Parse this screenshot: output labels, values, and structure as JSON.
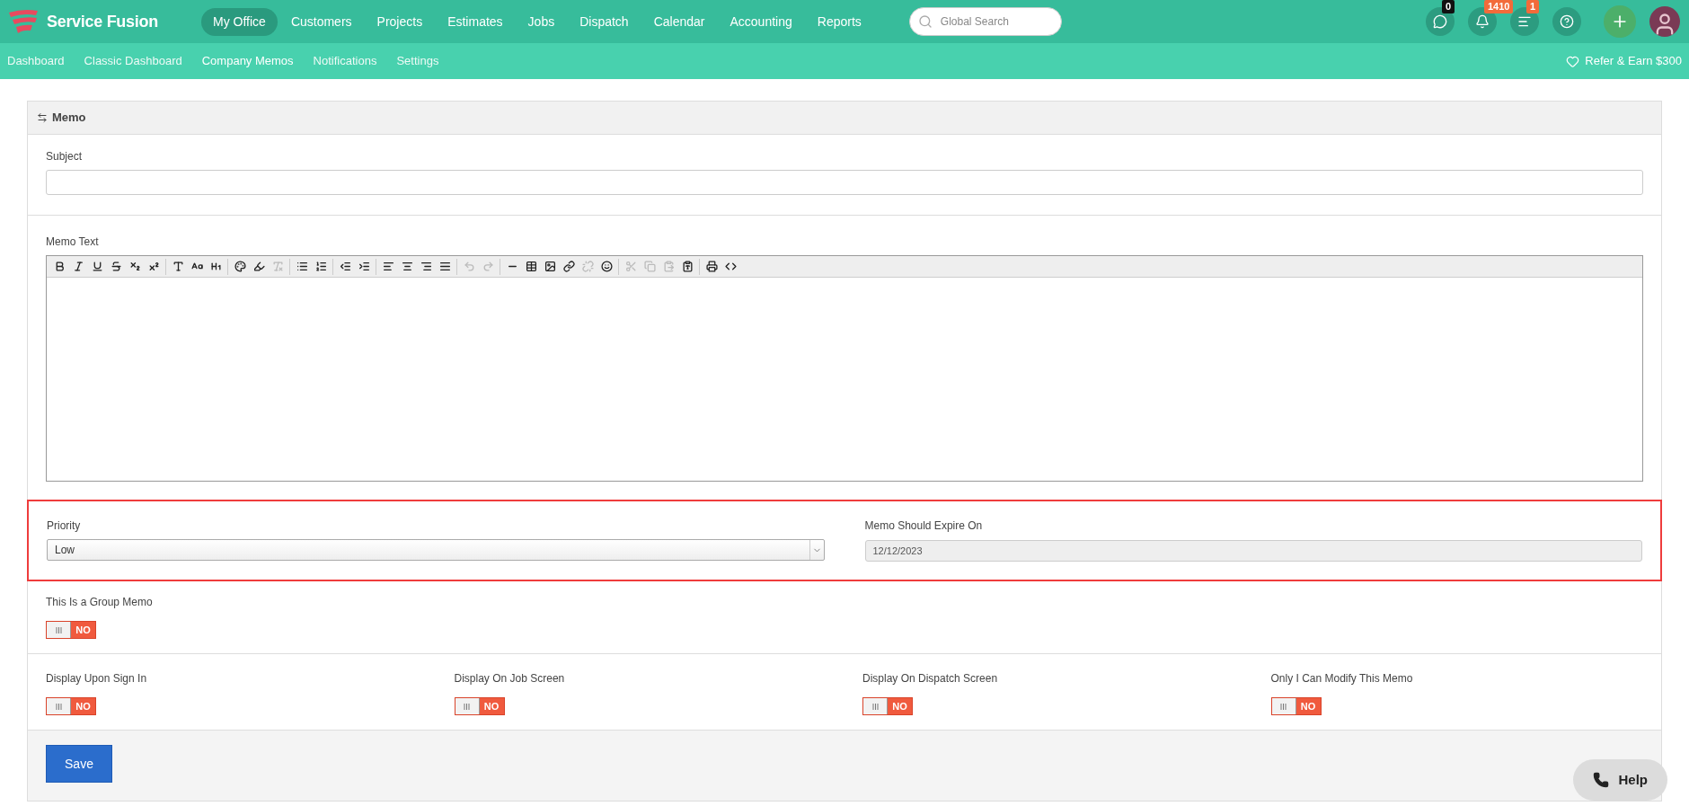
{
  "brand": {
    "name": "Service Fusion"
  },
  "main_nav": [
    {
      "label": "My Office",
      "selected": true
    },
    {
      "label": "Customers",
      "selected": false
    },
    {
      "label": "Projects",
      "selected": false
    },
    {
      "label": "Estimates",
      "selected": false
    },
    {
      "label": "Jobs",
      "selected": false
    },
    {
      "label": "Dispatch",
      "selected": false
    },
    {
      "label": "Calendar",
      "selected": false
    },
    {
      "label": "Accounting",
      "selected": false
    },
    {
      "label": "Reports",
      "selected": false
    }
  ],
  "search": {
    "placeholder": "Global Search"
  },
  "top_actions": [
    {
      "kind": "chat",
      "badge": "0",
      "color": "#111111"
    },
    {
      "kind": "bell",
      "badge": "1410",
      "color": "#f26b3a"
    },
    {
      "kind": "list",
      "badge": "1",
      "color": "#f26b3a"
    },
    {
      "kind": "help"
    },
    {
      "kind": "add"
    },
    {
      "kind": "avatar"
    }
  ],
  "sub_nav": [
    {
      "label": "Dashboard",
      "selected": false
    },
    {
      "label": "Classic Dashboard",
      "selected": false
    },
    {
      "label": "Company Memos",
      "selected": true
    },
    {
      "label": "Notifications",
      "selected": false
    },
    {
      "label": "Settings",
      "selected": false
    }
  ],
  "refer": {
    "label": "Refer & Earn $300"
  },
  "card": {
    "title": "Memo"
  },
  "subject": {
    "label": "Subject"
  },
  "memo_text": {
    "label": "Memo Text",
    "toolbar": [
      {
        "disabled": false
      },
      {
        "disabled": false
      },
      {
        "disabled": false
      },
      {
        "disabled": false
      },
      {
        "disabled": false
      },
      {
        "disabled": false
      },
      {
        "disabled": false
      },
      {
        "disabled": false
      },
      {
        "disabled": false
      },
      {
        "disabled": false
      },
      {
        "disabled": false
      },
      {
        "disabled": true
      },
      {
        "disabled": false
      },
      {
        "disabled": false
      },
      {
        "disabled": false
      },
      {
        "disabled": false
      },
      {
        "disabled": false
      },
      {
        "disabled": false
      },
      {
        "disabled": false
      },
      {
        "disabled": false
      },
      {
        "disabled": true
      },
      {
        "disabled": true
      },
      {
        "disabled": false
      },
      {
        "disabled": false
      },
      {
        "disabled": false
      },
      {
        "disabled": false
      },
      {
        "disabled": true
      },
      {
        "disabled": false
      },
      {
        "disabled": true
      },
      {
        "disabled": true
      },
      {
        "disabled": true
      },
      {
        "disabled": false
      },
      {
        "disabled": false
      },
      {
        "disabled": false
      }
    ]
  },
  "priority_section": {
    "highlighted": true,
    "priority": {
      "label": "Priority",
      "value": "Low"
    },
    "expire": {
      "label": "Memo Should Expire On",
      "value": "12/12/2023",
      "disabled": true
    }
  },
  "group_memo": {
    "label": "This Is a Group Memo",
    "on": false,
    "state_text": "NO"
  },
  "display_options": [
    {
      "label": "Display Upon Sign In",
      "on": false,
      "state_text": "NO"
    },
    {
      "label": "Display On Job Screen",
      "on": false,
      "state_text": "NO"
    },
    {
      "label": "Display On Dispatch Screen",
      "on": false,
      "state_text": "NO"
    },
    {
      "label": "Only I Can Modify This Memo",
      "on": false,
      "state_text": "NO"
    }
  ],
  "save_button": "Save",
  "help_button": "Help"
}
